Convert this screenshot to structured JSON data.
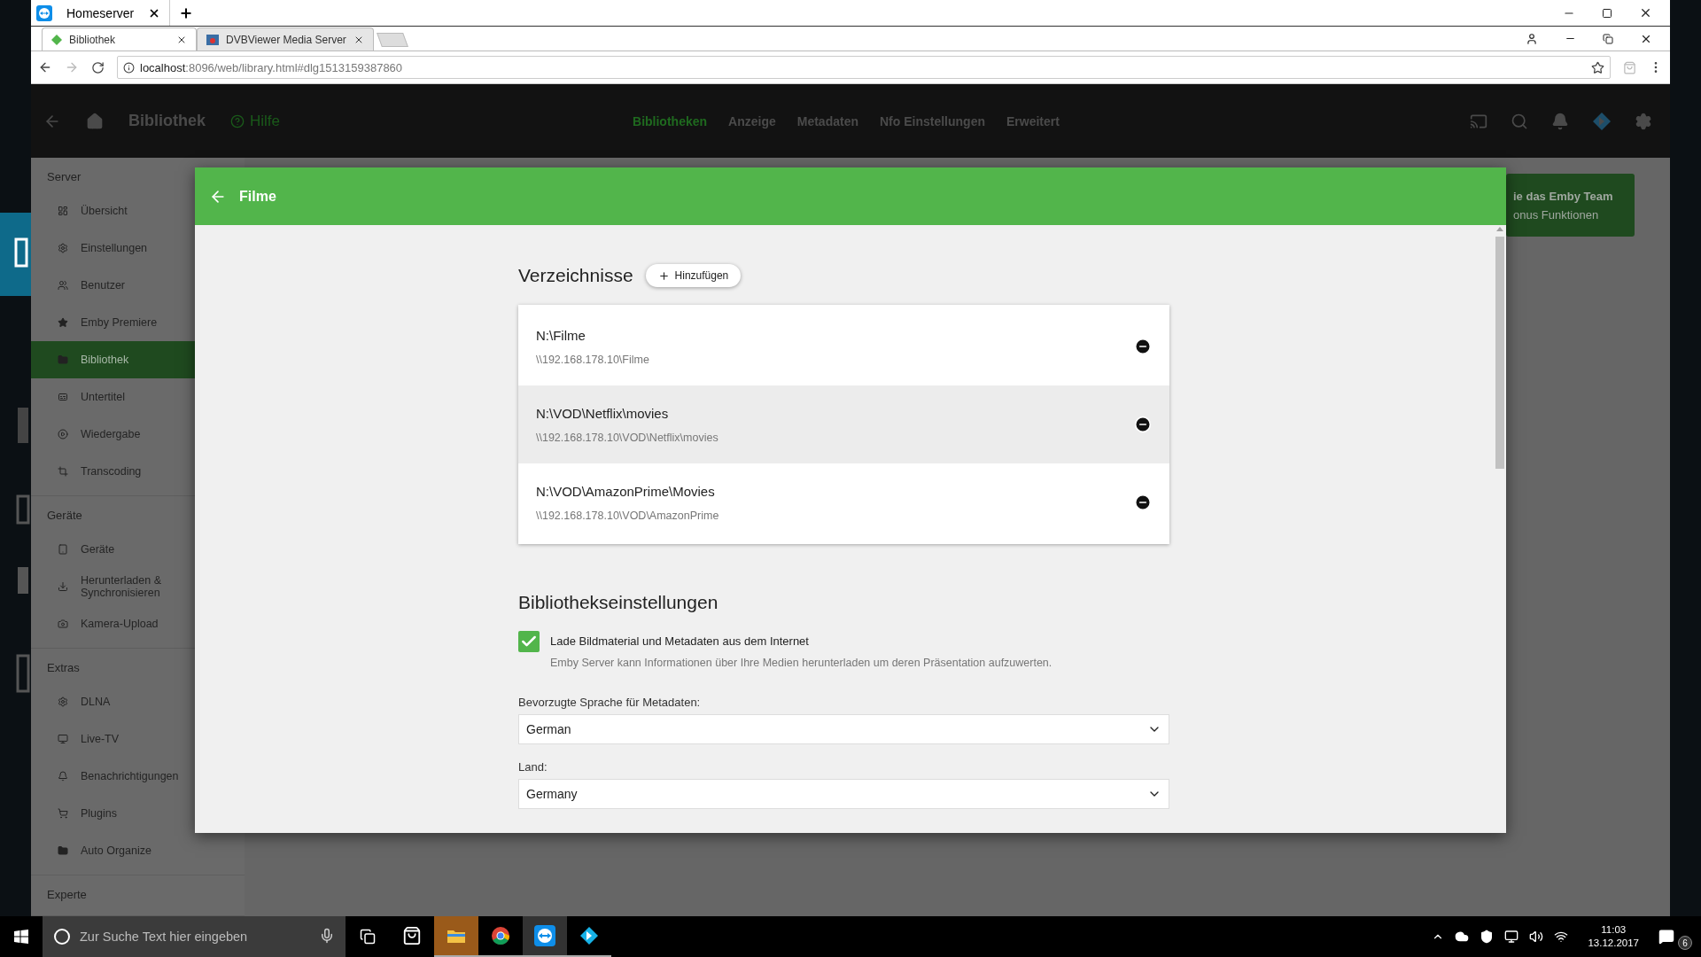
{
  "teamviewer": {
    "tabs": [
      {
        "label": "Homeserver",
        "selected": true
      }
    ]
  },
  "browser": {
    "tabs": [
      {
        "label": "Bibliothek",
        "selected": true
      },
      {
        "label": "DVBViewer Media Server",
        "selected": false
      }
    ],
    "url_host": "localhost",
    "url_rest": ":8096/web/library.html#dlg1513159387860"
  },
  "header": {
    "title": "Bibliothek",
    "help": "Hilfe",
    "tabs": [
      {
        "label": "Bibliotheken",
        "selected": true
      },
      {
        "label": "Anzeige",
        "selected": false
      },
      {
        "label": "Metadaten",
        "selected": false
      },
      {
        "label": "Nfo Einstellungen",
        "selected": false
      },
      {
        "label": "Erweitert",
        "selected": false
      }
    ]
  },
  "sidebar": {
    "sections": [
      {
        "title": "Server",
        "items": [
          {
            "kind": "dashboard",
            "label": "Übersicht",
            "selected": false
          },
          {
            "kind": "gear",
            "label": "Einstellungen",
            "selected": false
          },
          {
            "kind": "users",
            "label": "Benutzer",
            "selected": false
          },
          {
            "kind": "star",
            "label": "Emby Premiere",
            "selected": false
          },
          {
            "kind": "folder",
            "label": "Bibliothek",
            "selected": true
          },
          {
            "kind": "captions",
            "label": "Untertitel",
            "selected": false
          },
          {
            "kind": "play",
            "label": "Wiedergabe",
            "selected": false
          },
          {
            "kind": "crop",
            "label": "Transcoding",
            "selected": false
          }
        ]
      },
      {
        "title": "Geräte",
        "items": [
          {
            "kind": "tablet",
            "label": "Geräte",
            "selected": false
          },
          {
            "kind": "download",
            "label": "Herunterladen & Synchronisieren",
            "selected": false
          },
          {
            "kind": "camera",
            "label": "Kamera-Upload",
            "selected": false
          }
        ]
      },
      {
        "title": "Extras",
        "items": [
          {
            "kind": "gear",
            "label": "DLNA",
            "selected": false
          },
          {
            "kind": "tv",
            "label": "Live-TV",
            "selected": false
          },
          {
            "kind": "bell",
            "label": "Benachrichtigungen",
            "selected": false
          },
          {
            "kind": "cart",
            "label": "Plugins",
            "selected": false
          },
          {
            "kind": "folder",
            "label": "Auto Organize",
            "selected": false
          }
        ]
      },
      {
        "title": "Experte"
      }
    ]
  },
  "banner": {
    "lines": [
      "ie das Emby Team",
      "onus Funktionen"
    ]
  },
  "dialog": {
    "title": "Filme",
    "folders_heading": "Verzeichnisse",
    "add_button": "Hinzufügen",
    "folders": [
      {
        "path": "N:\\Filme",
        "network_path": "\\\\192.168.178.10\\Filme",
        "hovered": false
      },
      {
        "path": "N:\\VOD\\Netflix\\movies",
        "network_path": "\\\\192.168.178.10\\VOD\\Netflix\\movies",
        "hovered": true
      },
      {
        "path": "N:\\VOD\\AmazonPrime\\Movies",
        "network_path": "\\\\192.168.178.10\\VOD\\AmazonPrime",
        "hovered": false
      }
    ],
    "settings_heading": "Bibliothekseinstellungen",
    "download_option": {
      "label": "Lade Bildmaterial und Metadaten aus dem Internet",
      "description": "Emby Server kann Informationen über Ihre Medien herunterladen um deren Präsentation aufzuwerten.",
      "checked": true
    },
    "fields": [
      {
        "label": "Bevorzugte Sprache für Metadaten:",
        "value": "German"
      },
      {
        "label": "Land:",
        "value": "Germany"
      }
    ]
  },
  "taskbar": {
    "search_placeholder": "Zur Suche Text hier eingeben",
    "apps": [
      {
        "kind": "store",
        "running": false,
        "focused": false,
        "attention": false
      },
      {
        "kind": "explorer",
        "running": true,
        "focused": false,
        "attention": true
      },
      {
        "kind": "chrome",
        "running": true,
        "focused": false,
        "attention": false
      },
      {
        "kind": "teamviewer",
        "running": true,
        "focused": true,
        "attention": false
      },
      {
        "kind": "kodi",
        "running": true,
        "focused": false,
        "attention": false
      }
    ],
    "time": "11:03",
    "date": "13.12.2017",
    "notifications": "6"
  }
}
